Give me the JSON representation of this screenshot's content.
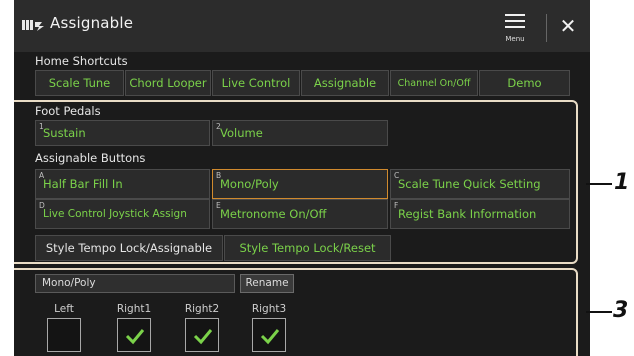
{
  "window": {
    "title": "Assignable",
    "menu_label": "Menu",
    "close_glyph": "✕",
    "app_icon": "piano-keys-icon"
  },
  "home_shortcuts": {
    "heading": "Home Shortcuts",
    "items": [
      "Scale Tune",
      "Chord Looper",
      "Live Control",
      "Assignable",
      "Channel On/Off",
      "Demo"
    ]
  },
  "foot_pedals": {
    "heading": "Foot Pedals",
    "items": [
      {
        "num": "1",
        "label": "Sustain"
      },
      {
        "num": "2",
        "label": "Volume"
      }
    ]
  },
  "assignable_buttons": {
    "heading": "Assignable Buttons",
    "items": [
      {
        "letter": "A",
        "label": "Half Bar Fill In"
      },
      {
        "letter": "B",
        "label": "Mono/Poly",
        "selected": true
      },
      {
        "letter": "C",
        "label": "Scale Tune Quick Setting"
      },
      {
        "letter": "D",
        "label": "Live Control Joystick Assign"
      },
      {
        "letter": "E",
        "label": "Metronome On/Off"
      },
      {
        "letter": "F",
        "label": "Regist Bank Information"
      }
    ]
  },
  "style_tempo": {
    "label": "Style Tempo Lock/Assignable",
    "value": "Style Tempo Lock/Reset"
  },
  "edit": {
    "name_value": "Mono/Poly",
    "rename_label": "Rename",
    "parts": [
      {
        "label": "Left",
        "checked": false
      },
      {
        "label": "Right1",
        "checked": true
      },
      {
        "label": "Right2",
        "checked": true
      },
      {
        "label": "Right3",
        "checked": true
      }
    ]
  },
  "callouts": [
    "1",
    "3"
  ],
  "colors": {
    "accent_green": "#7bd24a",
    "selected_border": "#d08a2e",
    "box_outline": "#e9dcc6"
  }
}
